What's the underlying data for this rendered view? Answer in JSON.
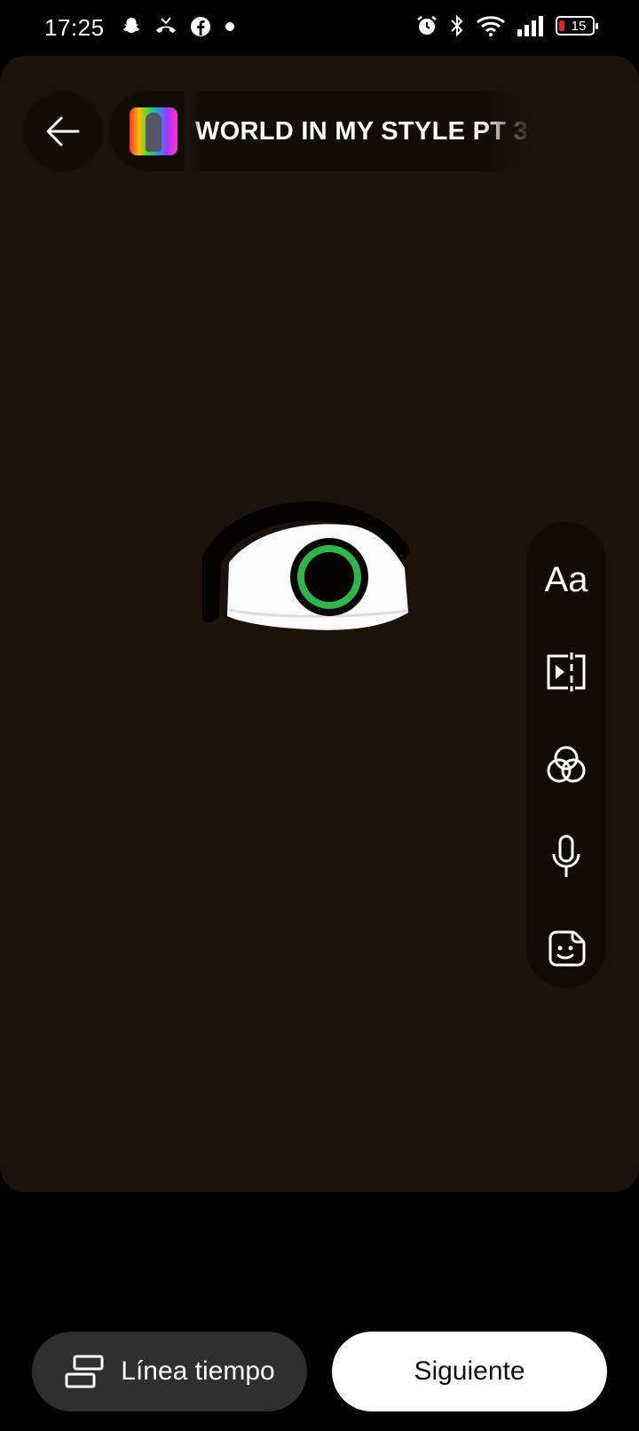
{
  "status_bar": {
    "time": "17:25",
    "battery": "15",
    "left_icons": [
      "snapchat-icon",
      "missed-call-icon",
      "facebook-icon",
      "dot-icon"
    ],
    "right_icons": [
      "alarm-icon",
      "bluetooth-icon",
      "wifi-icon",
      "signal-icon",
      "battery-icon"
    ]
  },
  "header": {
    "audio_title": "WORLD IN MY STYLE PT 3",
    "back_icon": "arrow-left-icon"
  },
  "tools": [
    {
      "name": "text-tool",
      "label": "Aa"
    },
    {
      "name": "clip-tool",
      "icon": "split-clip-icon"
    },
    {
      "name": "filter-tool",
      "icon": "filter-circles-icon"
    },
    {
      "name": "voiceover-tool",
      "icon": "microphone-icon"
    },
    {
      "name": "sticker-tool",
      "icon": "sticker-icon"
    }
  ],
  "footer": {
    "timeline_label": "Línea tiempo",
    "next_label": "Siguiente"
  },
  "colors": {
    "canvas_bg": "#1b120b",
    "iris": "#2fb54a",
    "next_button": "#ffffff",
    "timeline_button": "#2f2f2f"
  }
}
